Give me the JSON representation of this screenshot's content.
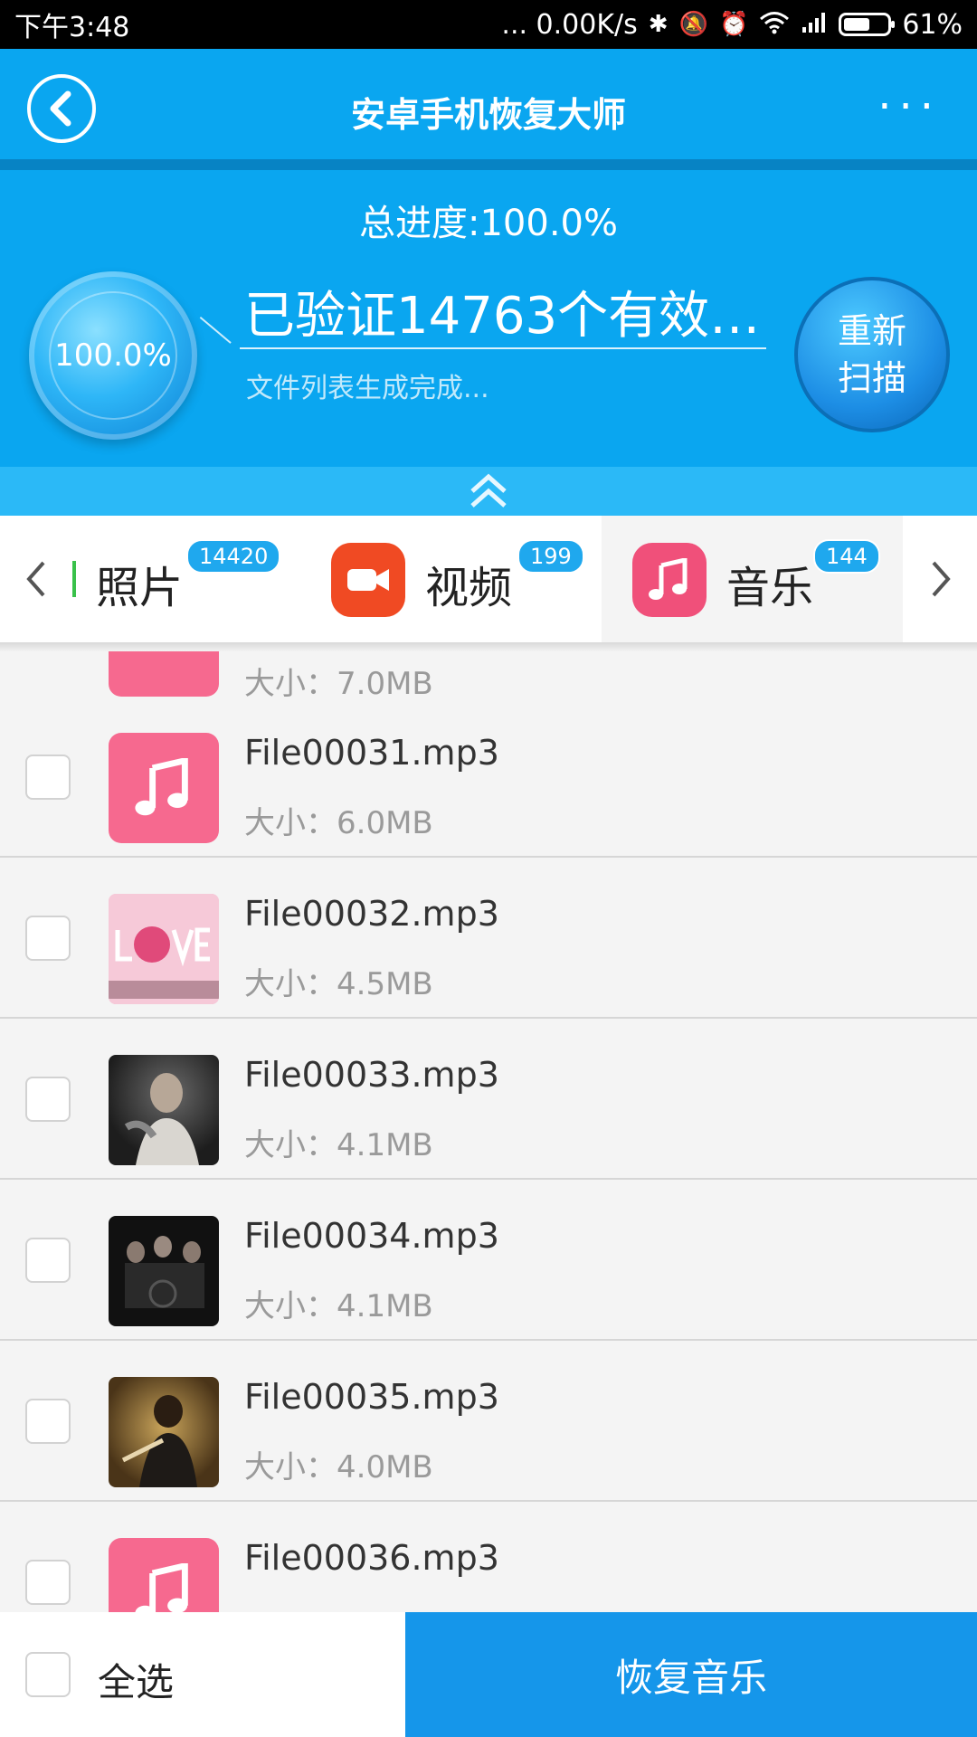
{
  "status_bar": {
    "time": "下午3:48",
    "network_speed": "... 0.00K/s",
    "battery_percent": "61%",
    "battery_level": 0.61
  },
  "header": {
    "title": "安卓手机恢复大师",
    "menu_icon": "more-dots-icon"
  },
  "progress": {
    "total_label": "总进度:100.0%",
    "gauge_value": "100.0%",
    "verified_text": "已验证14763个有效文...",
    "status_text": "文件列表生成完成...",
    "rescan_line1": "重新",
    "rescan_line2": "扫描"
  },
  "tabs": [
    {
      "label": "照片",
      "badge": "14420",
      "icon": "photo-icon"
    },
    {
      "label": "视频",
      "badge": "199",
      "icon": "video-camera-icon",
      "color": "#f04a23"
    },
    {
      "label": "音乐",
      "badge": "144",
      "icon": "music-note-icon",
      "color": "#f0507a",
      "active": true
    }
  ],
  "partial_item": {
    "size": "大小：7.0MB"
  },
  "files": [
    {
      "name": "File00031.mp3",
      "size": "大小：6.0MB",
      "thumb": "music-note"
    },
    {
      "name": "File00032.mp3",
      "size": "大小：4.5MB",
      "thumb": "album-love"
    },
    {
      "name": "File00033.mp3",
      "size": "大小：4.1MB",
      "thumb": "album-dark-portrait"
    },
    {
      "name": "File00034.mp3",
      "size": "大小：4.1MB",
      "thumb": "album-group-dark"
    },
    {
      "name": "File00035.mp3",
      "size": "大小：4.0MB",
      "thumb": "album-warm-portrait"
    },
    {
      "name": "File00036.mp3",
      "size": "",
      "thumb": "music-note"
    }
  ],
  "bottom": {
    "select_all": "全选",
    "recover_button": "恢复音乐"
  },
  "colors": {
    "header_blue": "#0aa6f0",
    "accent_blue": "#1596ea",
    "music_pink": "#f6698f",
    "video_orange": "#f04a23"
  }
}
